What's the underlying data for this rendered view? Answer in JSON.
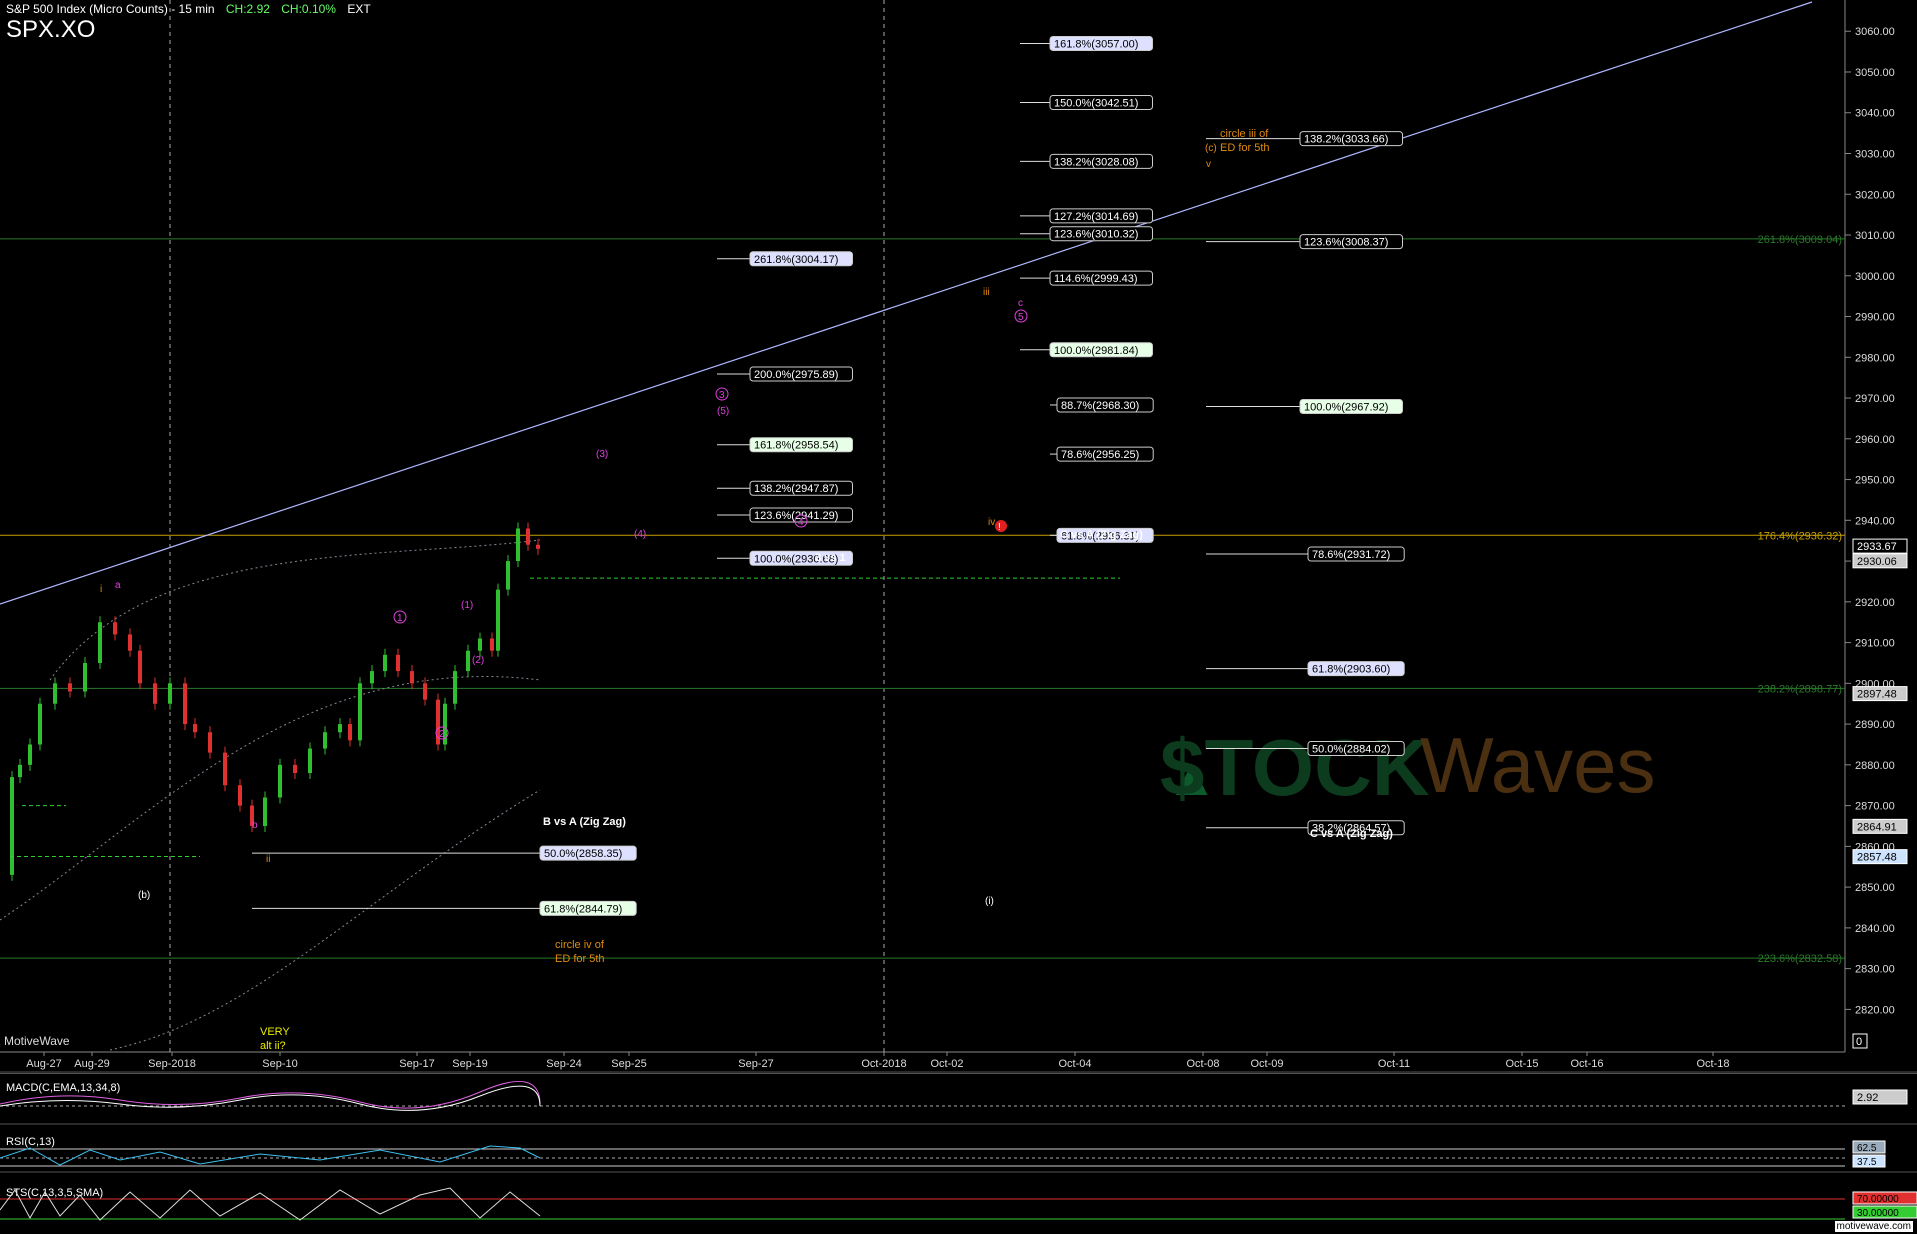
{
  "header": {
    "title": "S&P 500 Index (Micro Counts) - 15 min",
    "ch_points": "CH:2.92",
    "ch_percent": "CH:0.10%",
    "session": "EXT",
    "symbol": "SPX.XO"
  },
  "footer": {
    "brand": "MotiveWave",
    "site": "motivewave.com"
  },
  "colors": {
    "background": "#000000",
    "up_candle": "#2fbf2f",
    "down_candle": "#e03030",
    "trend_line": "#b0b8ff",
    "fib_h_green": "#2a7a2a",
    "fib_h_gold": "#c8a000",
    "wave_magenta": "#e040e0",
    "wave_orange": "#e08a10",
    "grid_dash": "#cccccc"
  },
  "watermark": {
    "stock": "$TOCK",
    "waves": "Waves"
  },
  "chart_data": {
    "type": "candlestick",
    "y_axis": {
      "ticks": [
        3060,
        3050,
        3040,
        3030,
        3020,
        3010,
        3000,
        2990,
        2980,
        2970,
        2960,
        2950,
        2940,
        2930,
        2920,
        2910,
        2900,
        2890,
        2880,
        2870,
        2860,
        2850,
        2840,
        2830,
        2820
      ],
      "min": 2812,
      "max": 3063
    },
    "x_axis": {
      "labels": [
        "Aug-27",
        "Aug-29",
        "Sep-2018",
        "Sep-10",
        "Sep-17",
        "Sep-19",
        "Sep-24",
        "Sep-25",
        "Sep-27",
        "Oct-2018",
        "Oct-02",
        "Oct-04",
        "Oct-08",
        "Oct-09",
        "Oct-11",
        "Oct-15",
        "Oct-16",
        "Oct-18"
      ]
    },
    "price_badges": [
      {
        "value": "2933.67",
        "style": "plain"
      },
      {
        "value": "2930.06",
        "style": "gray"
      },
      {
        "value": "2897.48",
        "style": "gray"
      },
      {
        "value": "2864.91",
        "style": "gray"
      },
      {
        "value": "2857.48",
        "style": "blue"
      }
    ],
    "axis_zero": "0",
    "fib_levels": [
      {
        "text": "161.8%(3057.00)",
        "price": 3057.0,
        "box": "blue"
      },
      {
        "text": "150.0%(3042.51)",
        "price": 3042.51,
        "box": "plain"
      },
      {
        "text": "138.2%(3028.08)",
        "price": 3028.08,
        "box": "plain"
      },
      {
        "text": "127.2%(3014.69)",
        "price": 3014.69,
        "box": "plain"
      },
      {
        "text": "123.6%(3010.32)",
        "price": 3010.32,
        "box": "plain"
      },
      {
        "text": "114.6%(2999.43)",
        "price": 2999.43,
        "box": "plain"
      },
      {
        "text": "100.0%(2981.84)",
        "price": 2981.84,
        "box": "green"
      },
      {
        "text": "88.7%(2968.30)",
        "price": 2968.3,
        "box": "plain"
      },
      {
        "text": "78.6%(2956.25)",
        "price": 2956.25,
        "box": "plain"
      },
      {
        "text": "61.8%(2936.31)",
        "price": 2936.31,
        "box": "blue"
      },
      {
        "text": "261.8%(3004.17)",
        "price": 3004.17,
        "box": "blue"
      },
      {
        "text": "200.0%(2975.89)",
        "price": 2975.89,
        "box": "plain"
      },
      {
        "text": "161.8%(2958.54)",
        "price": 2958.54,
        "box": "green"
      },
      {
        "text": "138.2%(2947.87)",
        "price": 2947.87,
        "box": "plain"
      },
      {
        "text": "123.6%(2941.29)",
        "price": 2941.29,
        "box": "plain"
      },
      {
        "text": "100.0%(2930.68)",
        "price": 2930.68,
        "box": "blue"
      },
      {
        "text": "138.2%(3033.66)",
        "price": 3033.66,
        "box": "plain"
      },
      {
        "text": "123.6%(3008.37)",
        "price": 3008.37,
        "box": "plain"
      },
      {
        "text": "100.0%(2967.92)",
        "price": 2967.92,
        "box": "green"
      },
      {
        "text": "78.6%(2931.72)",
        "price": 2931.72,
        "box": "plain"
      },
      {
        "text": "61.8%(2903.60)",
        "price": 2903.6,
        "box": "blue"
      },
      {
        "text": "50.0%(2884.02)",
        "price": 2884.02,
        "box": "plain"
      },
      {
        "text": "38.2%(2864.57)",
        "price": 2864.57,
        "box": "plain"
      },
      {
        "text": "50.0%(2858.35)",
        "price": 2858.35,
        "box": "blue"
      },
      {
        "text": "61.8%(2844.79)",
        "price": 2844.79,
        "box": "green"
      }
    ],
    "extension_labels": [
      {
        "text": "261.8%(3009.04)",
        "price": 3009.04
      },
      {
        "text": "176.4%(2936.32)",
        "price": 2936.32
      },
      {
        "text": "238.2%(2898.77)",
        "price": 2898.77
      },
      {
        "text": "223.6%(2832.58)",
        "price": 2832.58
      }
    ],
    "notes": [
      "C vs A (Zig Zag)",
      "3 vs 1",
      "B vs A (Zig Zag)",
      "C vs A (Zig Zag)",
      "circle iii of",
      "ED for 5th",
      "circle iv of",
      "ED for 5th",
      "VERY",
      "alt ii?"
    ],
    "wave_labels": [
      "a",
      "i",
      "b",
      "ii",
      "(b)",
      "1",
      "(1)",
      "(2)",
      "2",
      "(3)",
      "3",
      "(5)",
      "4",
      "(4)",
      "iii",
      "c",
      "5",
      "iv",
      "(c)",
      "v",
      "(i)"
    ],
    "indicators": [
      {
        "name": "MACD(C,EMA,13,34,8)",
        "value": "2.92"
      },
      {
        "name": "RSI(C,13)",
        "values": [
          "62.5",
          "37.5"
        ]
      },
      {
        "name": "STS(C,13,3,5,SMA)",
        "values": [
          "70.00000",
          "30.00000"
        ]
      }
    ]
  }
}
